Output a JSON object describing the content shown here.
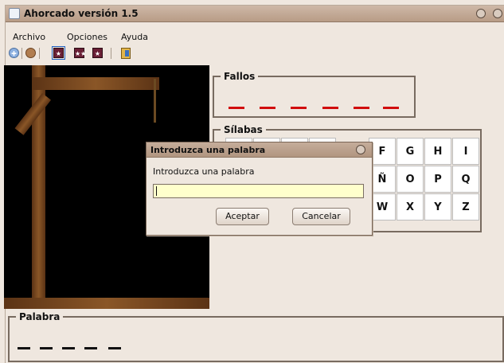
{
  "window": {
    "title": "Ahorcado versión 1.5"
  },
  "menubar": {
    "items": [
      "Archivo",
      "Opciones",
      "Ayuda"
    ]
  },
  "toolbar": {
    "buttons": [
      {
        "name": "plus-icon"
      },
      {
        "name": "hat-icon"
      },
      {
        "name": "one-star-level-icon",
        "label": "★"
      },
      {
        "name": "two-star-level-icon",
        "label": "★★"
      },
      {
        "name": "three-star-level-icon",
        "label": "★"
      },
      {
        "name": "exit-icon"
      }
    ]
  },
  "fallos": {
    "label": "Fallos",
    "dashes": 6,
    "color": "#d10d0d"
  },
  "silabas": {
    "label": "Sílabas",
    "rows": [
      [
        "",
        "",
        "",
        "",
        "F",
        "G",
        "H",
        "I"
      ],
      [
        "",
        "",
        "",
        "",
        "Ñ",
        "O",
        "P",
        "Q"
      ],
      [
        "",
        "",
        "",
        "",
        "W",
        "X",
        "Y",
        "Z"
      ]
    ]
  },
  "palabra": {
    "label": "Palabra",
    "dashes": 5
  },
  "dialog": {
    "title": "Introduzca una palabra",
    "prompt": "Introduzca una palabra",
    "input_value": "",
    "accept": "Aceptar",
    "cancel": "Cancelar"
  }
}
